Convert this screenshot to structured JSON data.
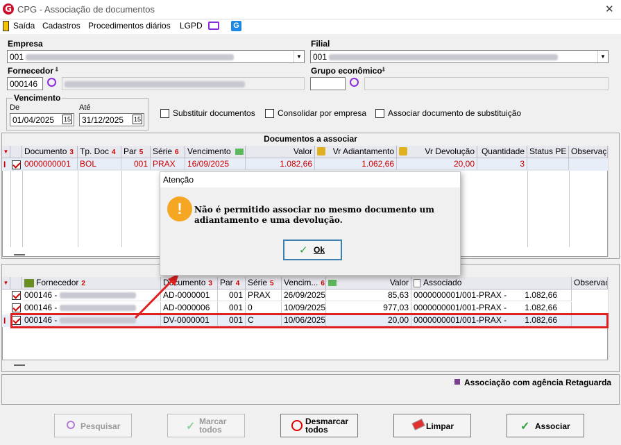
{
  "window": {
    "title": "CPG - Associação de documentos",
    "logo_letter": "G"
  },
  "menu": [
    "Saída",
    "Cadastros",
    "Procedimentos diários",
    "LGPD"
  ],
  "empresa": {
    "label": "Empresa",
    "value": "001"
  },
  "filial": {
    "label": "Filial",
    "value": "001"
  },
  "fornecedor": {
    "label": "Fornecedor",
    "value": "000146"
  },
  "grupo": {
    "label": "Grupo econômico",
    "value": ""
  },
  "vencimento": {
    "label": "Vencimento",
    "de_label": "De",
    "ate_label": "Até",
    "de": "01/04/2025",
    "ate": "31/12/2025",
    "cal": "15"
  },
  "options": [
    "Substituir documentos",
    "Consolidar por empresa",
    "Associar documento de substituição"
  ],
  "top_panel": {
    "title": "Documentos a associar",
    "headers": [
      "Documento",
      "Tp. Doc",
      "Par",
      "Série",
      "Vencimento",
      "Valor",
      "Vr Adiantamento",
      "Vr Devolução",
      "Quantidade",
      "Status PE",
      "Observaç"
    ],
    "sort": [
      "3",
      "4",
      "5",
      "6"
    ],
    "row": {
      "documento": "0000000001",
      "tpdoc": "BOL",
      "par": "001",
      "serie": "PRAX",
      "venc": "16/09/2025",
      "valor": "1.082,66",
      "adiant": "1.062,66",
      "devol": "20,00",
      "qtd": "3"
    }
  },
  "bottom_panel": {
    "headers": [
      "Fornecedor",
      "Documento",
      "Par",
      "Série",
      "Vencim...",
      "Valor",
      "Associado",
      "Observaç"
    ],
    "sort": [
      "2",
      "3",
      "4",
      "5",
      "6"
    ],
    "rows": [
      {
        "forn": "000146 -",
        "doc": "AD-0000001",
        "par": "001",
        "serie": "PRAX",
        "venc": "26/09/2025",
        "valor": "85,63",
        "assoc": "0000000001/001-PRAX -",
        "total": "1.082,66"
      },
      {
        "forn": "000146 -",
        "doc": "AD-0000006",
        "par": "001",
        "serie": "0",
        "venc": "10/09/2025",
        "valor": "977,03",
        "assoc": "0000000001/001-PRAX -",
        "total": "1.082,66"
      },
      {
        "forn": "000146 -",
        "doc": "DV-0000001",
        "par": "001",
        "serie": "C",
        "venc": "10/06/2025",
        "valor": "20,00",
        "assoc": "0000000001/001-PRAX -",
        "total": "1.082,66"
      }
    ]
  },
  "legend": "Associação com agência Retaguarda",
  "dialog": {
    "title": "Atenção",
    "message": "Não é permitido associar no mesmo documento um adiantamento e uma devolução.",
    "ok": "Ok",
    "icon_glyph": "!"
  },
  "buttons": {
    "pesquisar": "Pesquisar",
    "marcar": "Marcar todos",
    "desmarcar": "Desmarcar todos",
    "limpar": "Limpar",
    "associar": "Associar"
  },
  "colors": {
    "accent_red": "#e02020",
    "warning_orange": "#f5a623",
    "legend_purple": "#7b3f8f"
  }
}
